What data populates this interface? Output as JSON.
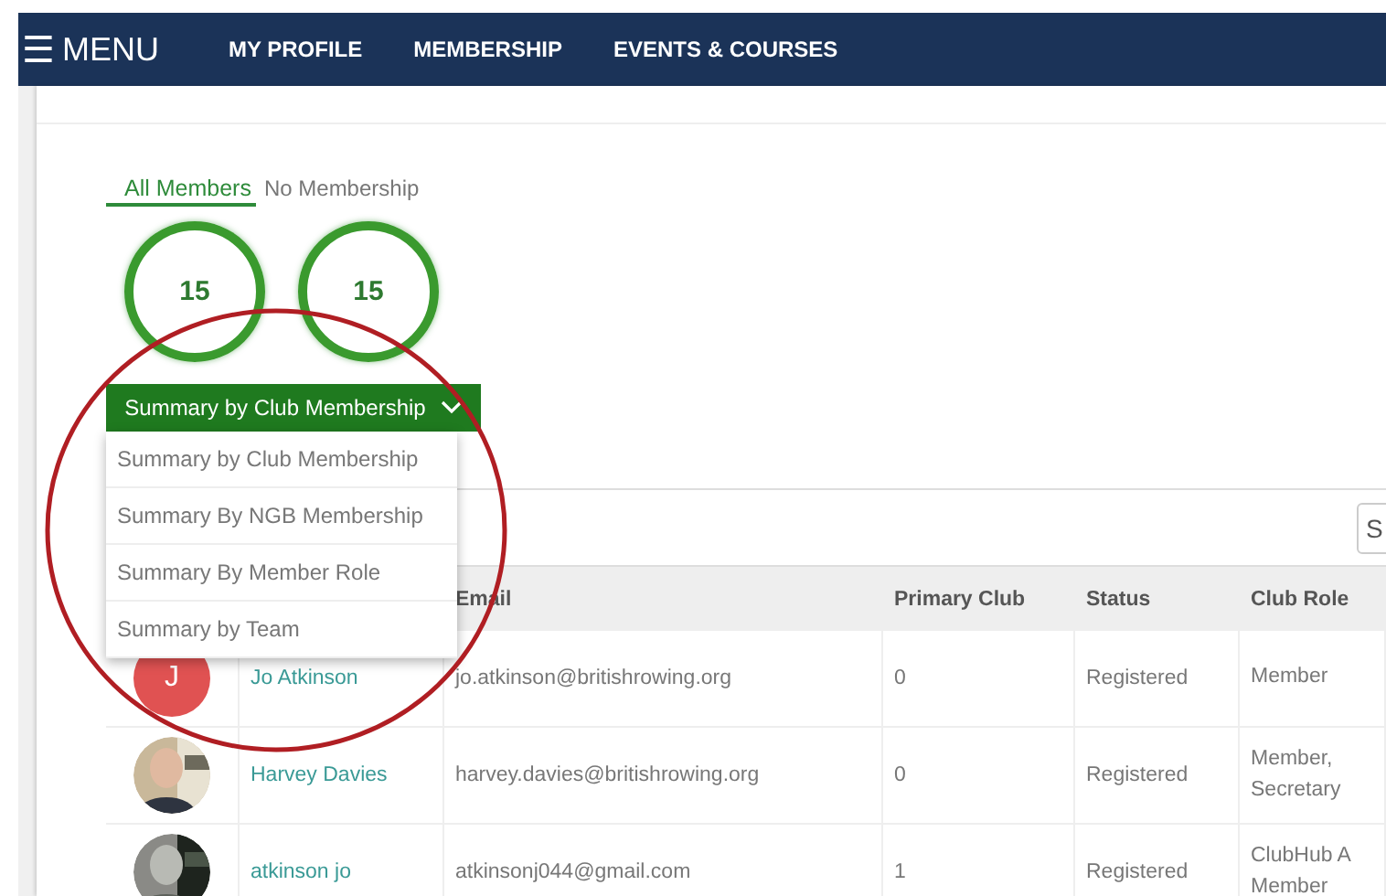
{
  "nav": {
    "menu_icon": "☰",
    "menu_label": "MENU",
    "links": [
      "MY PROFILE",
      "MEMBERSHIP",
      "EVENTS & COURSES"
    ]
  },
  "tabs": [
    {
      "label": "All Members",
      "selected": true
    },
    {
      "label": "No Membership",
      "selected": false
    }
  ],
  "counts": [
    "15",
    "15"
  ],
  "summary_dropdown": {
    "label": "Summary by Club Membership",
    "expanded": true,
    "options": [
      "Summary by Club Membership",
      "Summary By NGB Membership",
      "Summary By Member Role",
      "Summary by Team"
    ]
  },
  "search": {
    "placeholder": "S"
  },
  "table": {
    "columns": [
      "Email",
      "Primary Club",
      "Status",
      "Club Role"
    ],
    "rows": [
      {
        "avatar": {
          "kind": "initial",
          "initial": "J"
        },
        "name": "Jo Atkinson",
        "email": "jo.atkinson@britishrowing.org",
        "primary_club": "0",
        "status": "Registered",
        "club_role": "Member"
      },
      {
        "name": "Harvey Davies",
        "email": "harvey.davies@britishrowing.org",
        "primary_club": "0",
        "status": "Registered",
        "club_role": "Member, Secretary"
      },
      {
        "name": "atkinson jo",
        "email": "atkinsonj044@gmail.com",
        "primary_club": "1",
        "status": "Registered",
        "club_role": "ClubHub A Member"
      }
    ]
  }
}
